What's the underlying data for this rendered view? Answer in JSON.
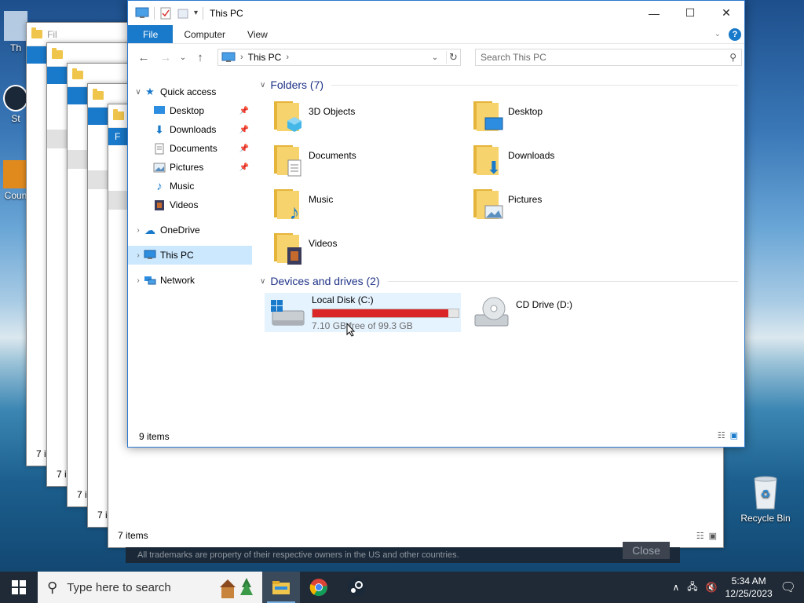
{
  "desktop": {
    "recycle_bin_label": "Recycle Bin",
    "partial_icon_labels": [
      "Th",
      "St",
      "Coun"
    ]
  },
  "background_windows": {
    "partial_tab": "Fil",
    "partial_tab_letter": "F",
    "items_count_labels": [
      "7 i",
      "7 i",
      "7 i",
      "7 i"
    ],
    "front_items": "7 items"
  },
  "banner": {
    "trademark_text": "All trademarks are property of their respective owners in the US and other countries.",
    "close_label": "Close"
  },
  "window": {
    "title": "This PC",
    "ribbon_tabs": [
      "File",
      "Computer",
      "View"
    ],
    "address": {
      "location": "This PC"
    },
    "search_placeholder": "Search This PC",
    "status": "9 items"
  },
  "sidebar": {
    "quick_access": "Quick access",
    "quick_items": [
      {
        "label": "Desktop",
        "icon": "desktop-icon",
        "pinned": true
      },
      {
        "label": "Downloads",
        "icon": "downloads-icon",
        "pinned": true
      },
      {
        "label": "Documents",
        "icon": "documents-icon",
        "pinned": true
      },
      {
        "label": "Pictures",
        "icon": "pictures-icon",
        "pinned": true
      },
      {
        "label": "Music",
        "icon": "music-icon",
        "pinned": false
      },
      {
        "label": "Videos",
        "icon": "videos-icon",
        "pinned": false
      }
    ],
    "onedrive": "OneDrive",
    "this_pc": "This PC",
    "network": "Network"
  },
  "folders_group": {
    "header": "Folders (7)",
    "items": [
      "3D Objects",
      "Desktop",
      "Documents",
      "Downloads",
      "Music",
      "Pictures",
      "Videos"
    ]
  },
  "devices_group": {
    "header": "Devices and drives (2)",
    "local_disk": {
      "name": "Local Disk (C:)",
      "free_text": "7.10 GB free of 99.3 GB",
      "used_fraction": 0.93
    },
    "cd_drive": {
      "name": "CD Drive (D:)"
    }
  },
  "taskbar": {
    "search_placeholder": "Type here to search",
    "time": "5:34 AM",
    "date": "12/25/2023"
  },
  "colors": {
    "accent": "#1979ca",
    "selection": "#cce8ff",
    "disk_bar": "#da2626",
    "group_header": "#1e3287"
  }
}
